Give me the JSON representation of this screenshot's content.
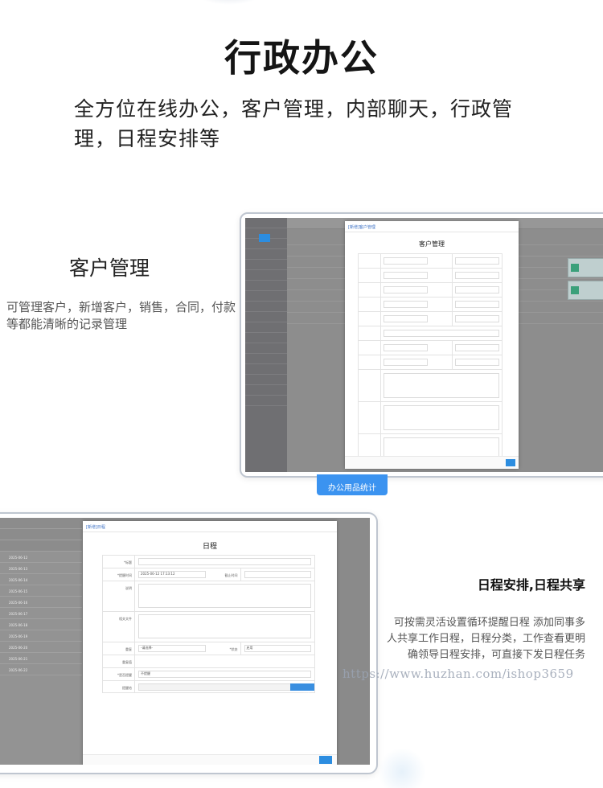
{
  "hero": {
    "title": "行政办公",
    "subtitle": "全方位在线办公，客户管理，内部聊天，行政管理，日程安排等"
  },
  "customer": {
    "title": "客户管理",
    "description": "可管理客户，新增客户，销售，合同，付款等都能清晰的记录管理",
    "modal_header": "[新增]客户管理",
    "modal_title": "客户管理"
  },
  "badge": {
    "label": "办公用品统计"
  },
  "schedule": {
    "title": "日程安排,日程共享",
    "description": "可按需灵活设置循环提醒日程 添加同事多人共享工作日程，日程分类，工作查看更明确领导日程安排，可直接下发日程任务",
    "modal_header": "[新增]日程",
    "modal_title": "日程",
    "fields": {
      "title_label": "*标题",
      "time_label": "*提醒时间",
      "time_value": "2025-06-12 17:13:12",
      "end_label": "截止时间",
      "desc_label": "说明",
      "file_label": "相关文件",
      "repeat_label": "重复",
      "repeat_value": "-请选择-",
      "status_label": "*状态",
      "status_value": "启用",
      "share_label": "重复值",
      "remind_label": "*是否提醒",
      "remind_value": "不提醒",
      "person_label": "提醒给",
      "pick_label": "选择"
    },
    "list_rows": [
      "2025-06-12",
      "2025-06-13",
      "2025-06-14",
      "2025-06-15",
      "2025-06-16",
      "2025-06-17",
      "2025-06-18",
      "2025-06-19",
      "2025-06-20",
      "2025-06-21",
      "2025-06-22"
    ]
  },
  "watermark": {
    "text": "https://www.huzhan.com/ishop3659"
  }
}
